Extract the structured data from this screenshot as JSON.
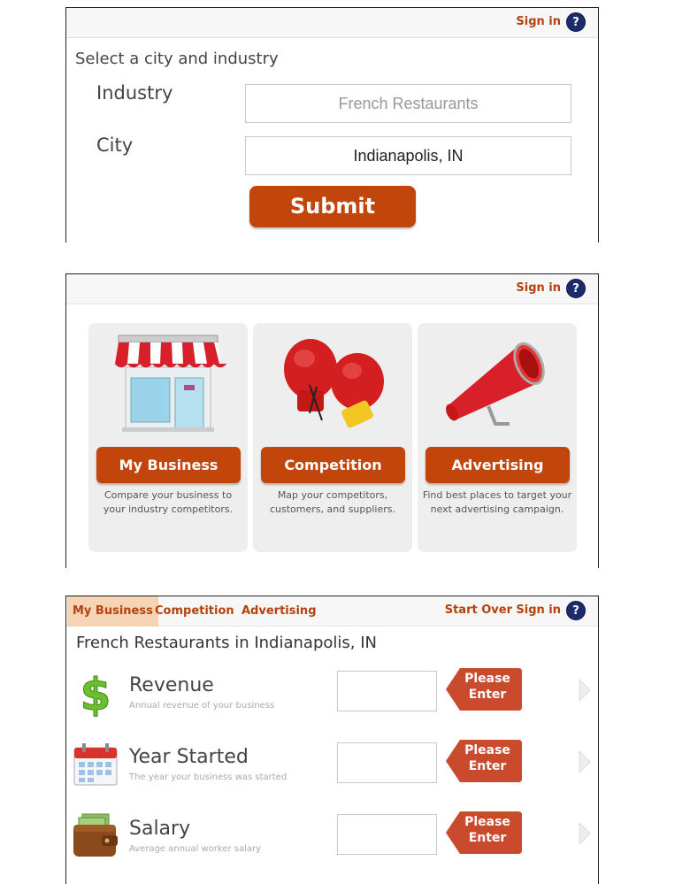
{
  "panel1": {
    "sign_in": "Sign in",
    "help": "?",
    "heading": "Select a city and industry",
    "industry_label": "Industry",
    "industry_value": "French Restaurants",
    "city_label": "City",
    "city_value": "Indianapolis, IN",
    "submit_label": "Submit"
  },
  "panel2": {
    "sign_in": "Sign in",
    "help": "?",
    "cards": [
      {
        "label": "My Business",
        "desc": "Compare your business to your industry competitors.",
        "icon": "storefront-icon"
      },
      {
        "label": "Competition",
        "desc": "Map your competitors, customers, and suppliers.",
        "icon": "boxing-gloves-icon"
      },
      {
        "label": "Advertising",
        "desc": "Find best places to target your next advertising campaign.",
        "icon": "megaphone-icon"
      }
    ]
  },
  "panel3": {
    "tabs": [
      "My Business",
      "Competition",
      "Advertising"
    ],
    "start_over": "Start Over",
    "sign_in": "Sign in",
    "help": "?",
    "heading": "French Restaurants in Indianapolis, IN",
    "rows": [
      {
        "title": "Revenue",
        "sub": "Annual revenue of your business",
        "badge": "Please Enter",
        "icon": "dollar-icon"
      },
      {
        "title": "Year Started",
        "sub": "The year your business was started",
        "badge": "Please Enter",
        "icon": "calendar-icon"
      },
      {
        "title": "Salary",
        "sub": "Average annual worker salary",
        "badge": "Please Enter",
        "icon": "wallet-icon"
      }
    ]
  },
  "colors": {
    "accent": "#c2450b",
    "link": "#b5420e",
    "help_bg": "#1c2b6b",
    "active_tab": "#f6d3b4",
    "card_bg": "#eeeeee",
    "badge": "#c94a2c"
  }
}
